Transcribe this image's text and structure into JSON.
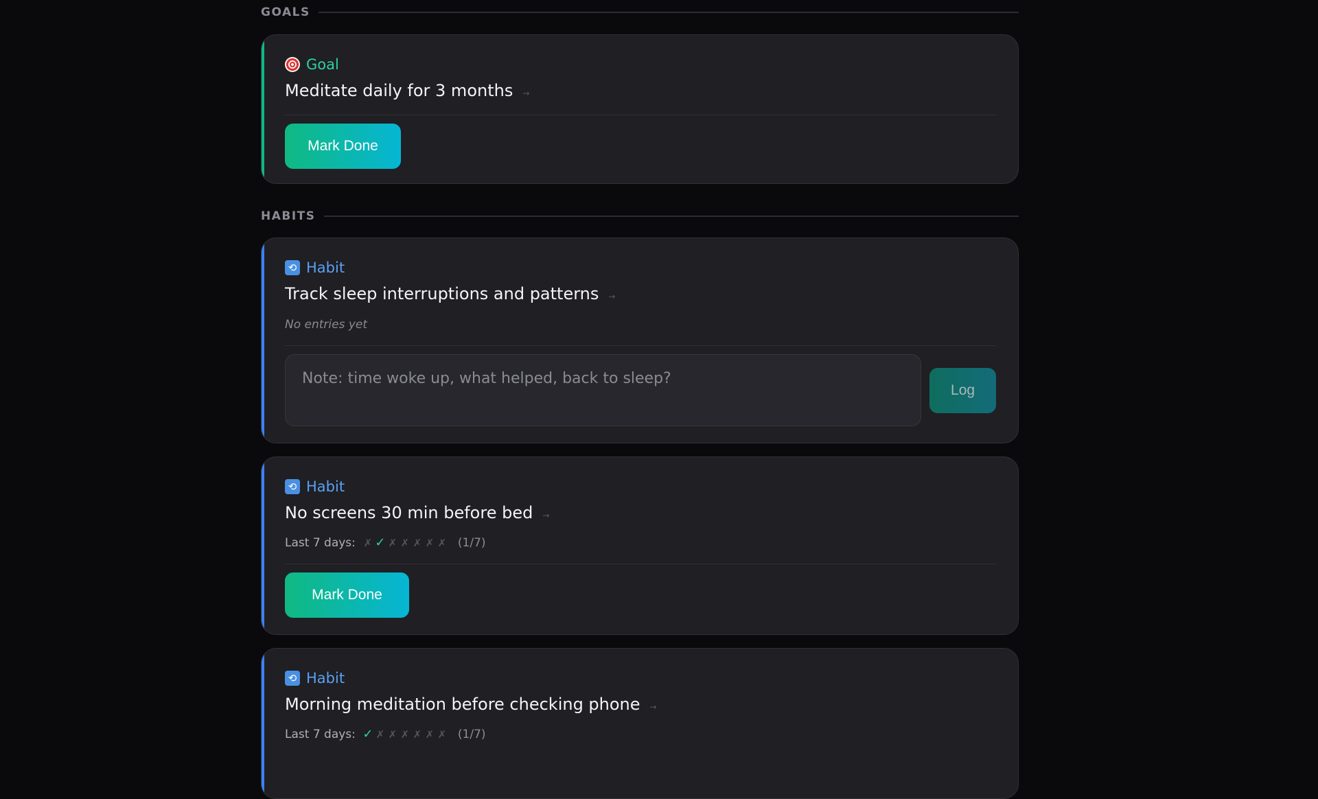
{
  "goals_section": {
    "label": "GOALS"
  },
  "habits_section": {
    "label": "HABITS"
  },
  "goals": [
    {
      "type_label": "Goal",
      "title": "Meditate daily for 3 months",
      "arrow": "→",
      "action_label": "Mark Done",
      "icon": "target-icon"
    }
  ],
  "habits": [
    {
      "type_label": "Habit",
      "title": "Track sleep interruptions and patterns",
      "arrow": "→",
      "status_text": "No entries yet",
      "note_placeholder": "Note: time woke up, what helped, back to sleep?",
      "note_value": "",
      "action_label": "Log",
      "icon": "cycle-icon"
    },
    {
      "type_label": "Habit",
      "title": "No screens 30 min before bed",
      "arrow": "→",
      "days_label": "Last 7 days:",
      "days": [
        "✗",
        "✓",
        "✗",
        "✗",
        "✗",
        "✗",
        "✗"
      ],
      "days_done": [
        false,
        true,
        false,
        false,
        false,
        false,
        false
      ],
      "days_count": "(1/7)",
      "action_label": "Mark Done",
      "icon": "cycle-icon"
    },
    {
      "type_label": "Habit",
      "title": "Morning meditation before checking phone",
      "arrow": "→",
      "days_label": "Last 7 days:",
      "days": [
        "✓",
        "✗",
        "✗",
        "✗",
        "✗",
        "✗",
        "✗"
      ],
      "days_done": [
        true,
        false,
        false,
        false,
        false,
        false,
        false
      ],
      "days_count": "(1/7)",
      "icon": "cycle-icon"
    }
  ],
  "colors": {
    "goal_accent": "#10b981",
    "habit_accent": "#3b82f6",
    "done_check": "#2ed1a3",
    "background": "#0a0a0d",
    "card": "#1f1f24"
  }
}
